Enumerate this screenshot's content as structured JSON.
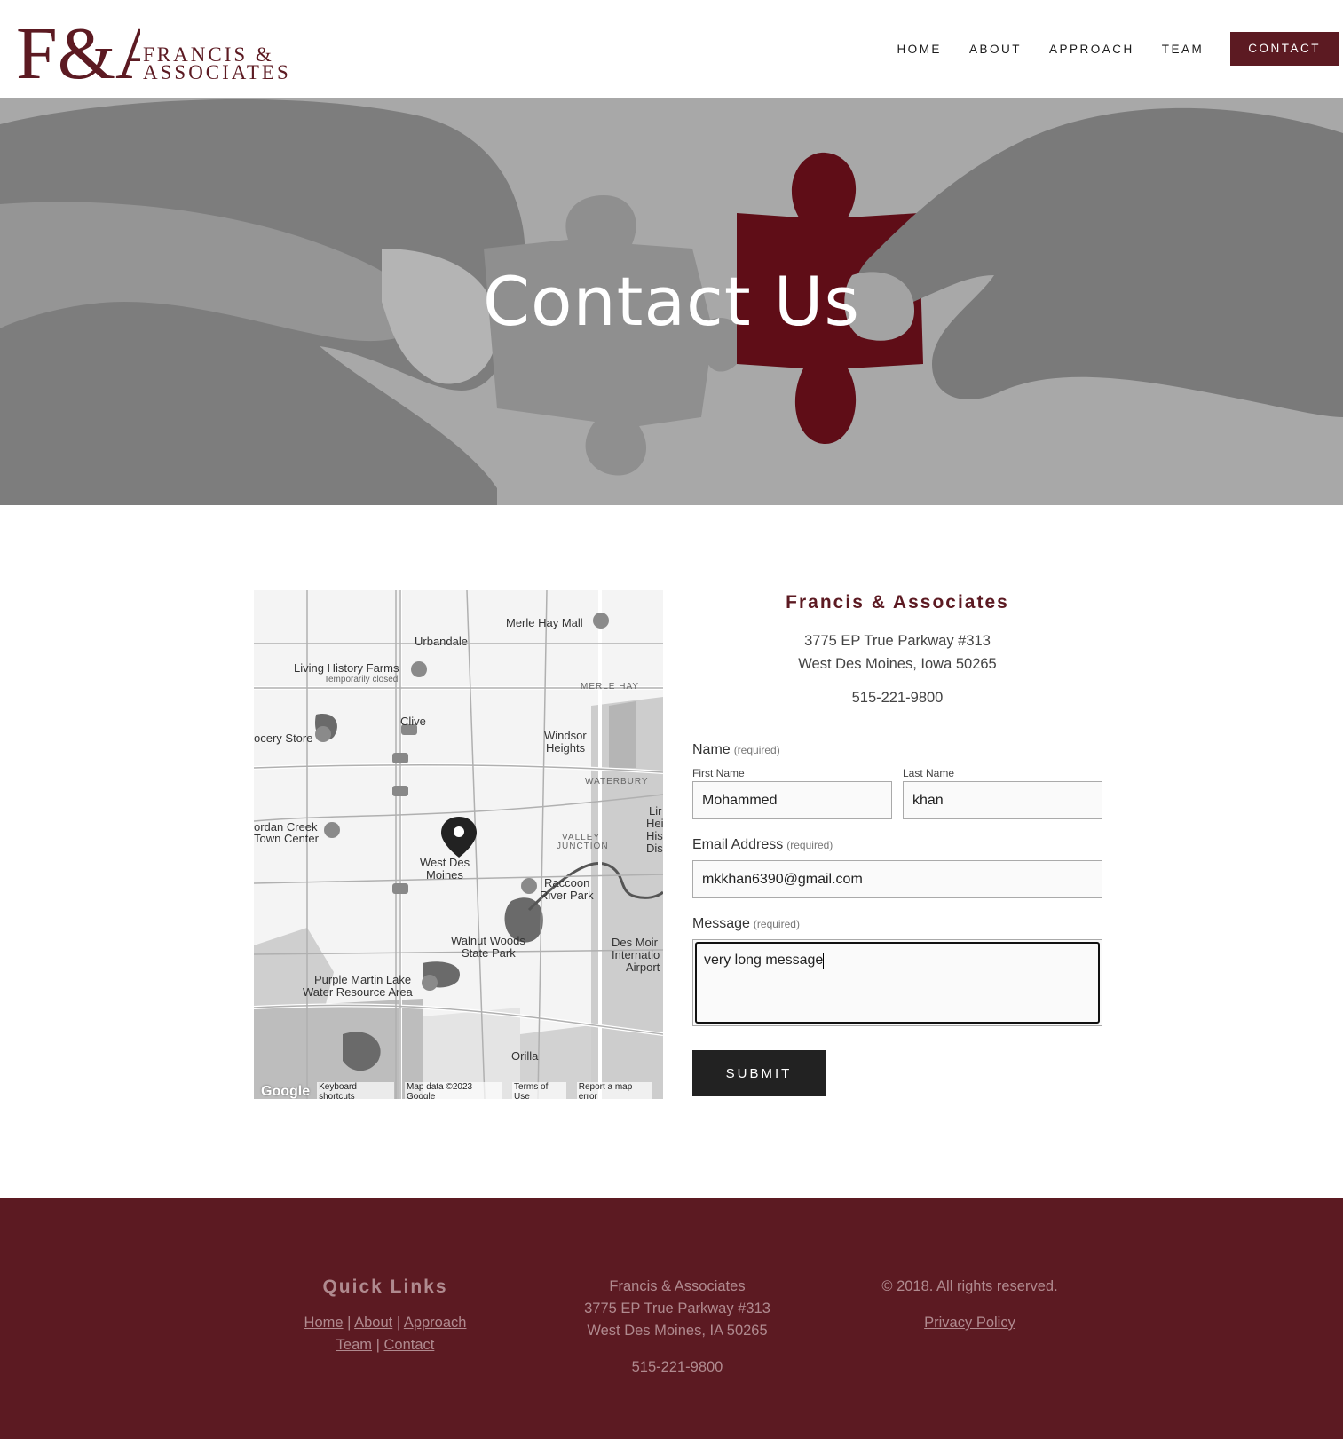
{
  "header": {
    "logo_monogram": "F&A",
    "logo_line1": "FRANCIS &",
    "logo_line2": "ASSOCIATES",
    "nav": [
      "HOME",
      "ABOUT",
      "APPROACH",
      "TEAM",
      "CONTACT"
    ]
  },
  "hero": {
    "title": "Contact Us"
  },
  "map": {
    "labels": {
      "merle_hay_mall": "Merle Hay Mall",
      "urbandale": "Urbandale",
      "living_history": "Living History Farms",
      "temp_closed": "Temporarily closed",
      "merle_hay": "MERLE HAY",
      "clive": "Clive",
      "grocery": "ocery Store",
      "windsor1": "Windsor",
      "windsor2": "Heights",
      "waterbury": "WATERBURY",
      "jordan1": "ordan Creek",
      "jordan2": "Town Center",
      "valley1": "VALLEY",
      "valley2": "JUNCTION",
      "wdm1": "West Des",
      "wdm2": "Moines",
      "raccoon1": "Raccoon",
      "raccoon2": "River Park",
      "walnut1": "Walnut Woods",
      "walnut2": "State Park",
      "dsm1": "Des Moir",
      "dsm2": "Internatio",
      "dsm3": "Airport",
      "purple1": "Purple Martin Lake",
      "purple2": "Water Resource Area",
      "orilla": "Orilla",
      "lin1": "Lir",
      "lin2": "Hei",
      "lin3": "His",
      "lin4": "Dis"
    },
    "footer": {
      "google": "Google",
      "keyboard": "Keyboard shortcuts",
      "data": "Map data ©2023 Google",
      "terms": "Terms of Use",
      "report": "Report a map error"
    }
  },
  "info": {
    "firm": "Francis & Associates",
    "addr1": "3775 EP True Parkway #313",
    "addr2": "West Des Moines, Iowa 50265",
    "phone": "515-221-9800"
  },
  "form": {
    "name_label": "Name",
    "required": "(required)",
    "first_label": "First Name",
    "first_value": "Mohammed",
    "last_label": "Last Name",
    "last_value": "khan",
    "email_label": "Email Address",
    "email_value": "mkkhan6390@gmail.com",
    "message_label": "Message",
    "message_value": "very long message",
    "submit": "SUBMIT"
  },
  "footer": {
    "quick_links": "Quick Links",
    "links_row1": [
      "Home",
      "About",
      "Approach"
    ],
    "links_row2": [
      "Team",
      "Contact"
    ],
    "sep": "|",
    "firm": "Francis & Associates",
    "addr1": "3775 EP True Parkway #313",
    "addr2": "West Des Moines, IA  50265",
    "phone": "515-221-9800",
    "copyright": "© 2018. All rights reserved.",
    "privacy": "Privacy Policy"
  },
  "colors": {
    "brand": "#5c1a22",
    "dark_button": "#222222"
  }
}
